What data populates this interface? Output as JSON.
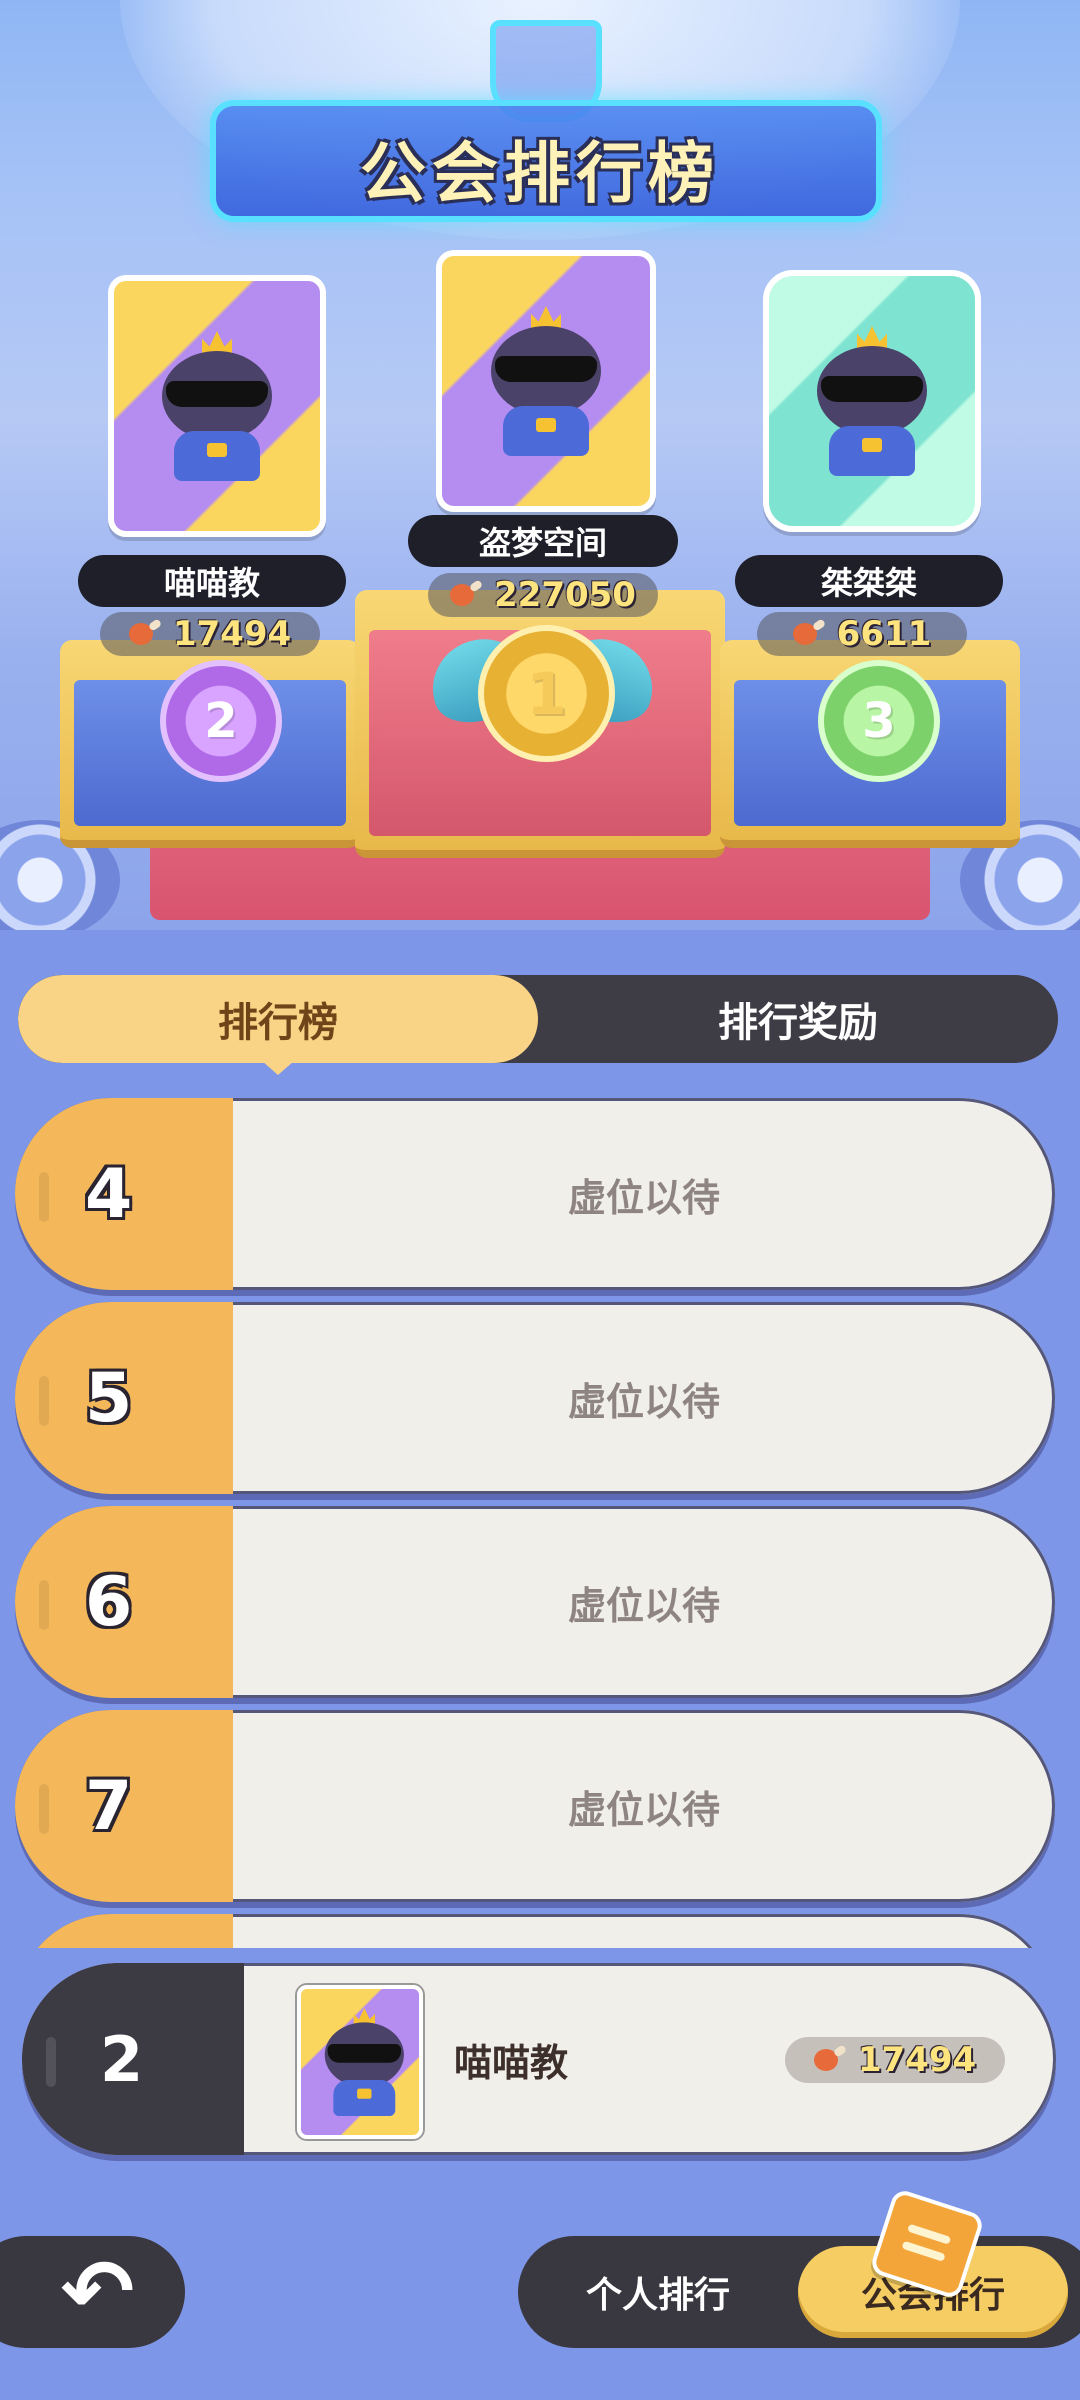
{
  "header": {
    "title": "公会排行榜"
  },
  "podium": [
    {
      "rank": "2",
      "name": "喵喵教",
      "score": "17494",
      "card_style": "gold"
    },
    {
      "rank": "1",
      "name": "盗梦空间",
      "score": "227050",
      "card_style": "gold"
    },
    {
      "rank": "3",
      "name": "桀桀桀",
      "score": "6611",
      "card_style": "green"
    }
  ],
  "tabs": [
    {
      "label": "排行榜",
      "active": true
    },
    {
      "label": "排行奖励",
      "active": false
    }
  ],
  "list": [
    {
      "rank": "4",
      "status": "虚位以待"
    },
    {
      "rank": "5",
      "status": "虚位以待"
    },
    {
      "rank": "6",
      "status": "虚位以待"
    },
    {
      "rank": "7",
      "status": "虚位以待"
    }
  ],
  "my_rank": {
    "rank": "2",
    "name": "喵喵教",
    "score": "17494"
  },
  "bottom_nav": {
    "personal_label": "个人排行",
    "guild_label": "公会排行",
    "active": "guild"
  },
  "colors": {
    "accent_gold": "#f4b85a",
    "tab_active": "#f9d487",
    "dark_pill": "#3e3d45",
    "score_text": "#fde47e"
  }
}
